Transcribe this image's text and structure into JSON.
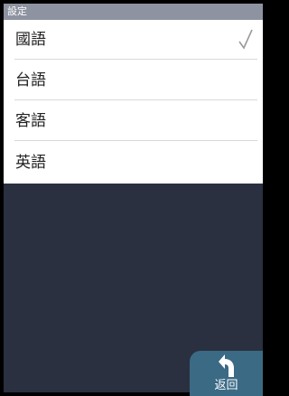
{
  "titlebar": {
    "title": "設定"
  },
  "languages": {
    "items": [
      {
        "label": "國語",
        "selected": true
      },
      {
        "label": "台語",
        "selected": false
      },
      {
        "label": "客語",
        "selected": false
      },
      {
        "label": "英語",
        "selected": false
      }
    ]
  },
  "footer": {
    "back_label": "返回"
  },
  "icons": {
    "selected": "checkmark-icon",
    "back": "back-arrow-icon"
  },
  "colors": {
    "titlebar": "#8e93a1",
    "background": "#2a3040",
    "back_button": "#3b6a85"
  }
}
